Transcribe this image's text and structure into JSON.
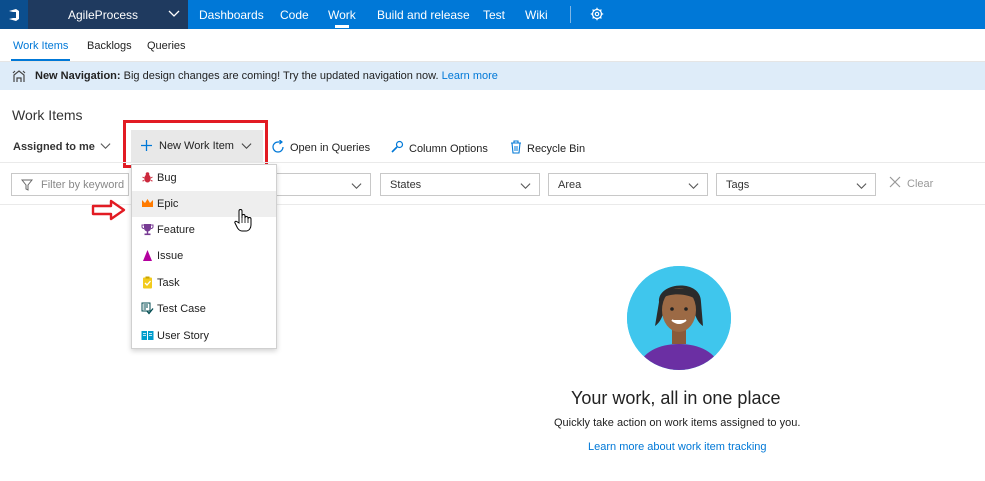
{
  "header": {
    "project": "AgileProcess",
    "hubs": [
      {
        "label": "Dashboards"
      },
      {
        "label": "Code"
      },
      {
        "label": "Work"
      },
      {
        "label": "Build and release"
      },
      {
        "label": "Test"
      },
      {
        "label": "Wiki"
      }
    ]
  },
  "subnav": {
    "tabs": [
      {
        "label": "Work Items"
      },
      {
        "label": "Backlogs"
      },
      {
        "label": "Queries"
      }
    ]
  },
  "banner": {
    "bold": "New Navigation:",
    "text": " Big design changes are coming! Try the updated navigation now. ",
    "link": "Learn more"
  },
  "page": {
    "title": "Work Items"
  },
  "toolbar": {
    "assigned": "Assigned to me",
    "new_item": "New Work Item",
    "open_queries": "Open in Queries",
    "column_options": "Column Options",
    "recycle_bin": "Recycle Bin"
  },
  "filters": {
    "keyword_placeholder": "Filter by keyword",
    "states": "States",
    "area": "Area",
    "tags": "Tags",
    "clear": "Clear"
  },
  "menu": {
    "items": [
      {
        "label": "Bug",
        "icon": "bug-icon",
        "color": "#cc293d"
      },
      {
        "label": "Epic",
        "icon": "crown-icon",
        "color": "#ff7b00"
      },
      {
        "label": "Feature",
        "icon": "trophy-icon",
        "color": "#773b93"
      },
      {
        "label": "Issue",
        "icon": "issue-icon",
        "color": "#b4009e"
      },
      {
        "label": "Task",
        "icon": "clipboard-icon",
        "color": "#f2cb1d"
      },
      {
        "label": "Test Case",
        "icon": "test-case-icon",
        "color": "#004b50"
      },
      {
        "label": "User Story",
        "icon": "book-icon",
        "color": "#009ccc"
      }
    ]
  },
  "empty_state": {
    "title": "Your work, all in one place",
    "subtitle": "Quickly take action on work items assigned to you.",
    "link": "Learn more about work item tracking"
  },
  "colors": {
    "accent": "#0078d7",
    "highlight": "#e21b23",
    "banner_bg": "#deecf9"
  }
}
